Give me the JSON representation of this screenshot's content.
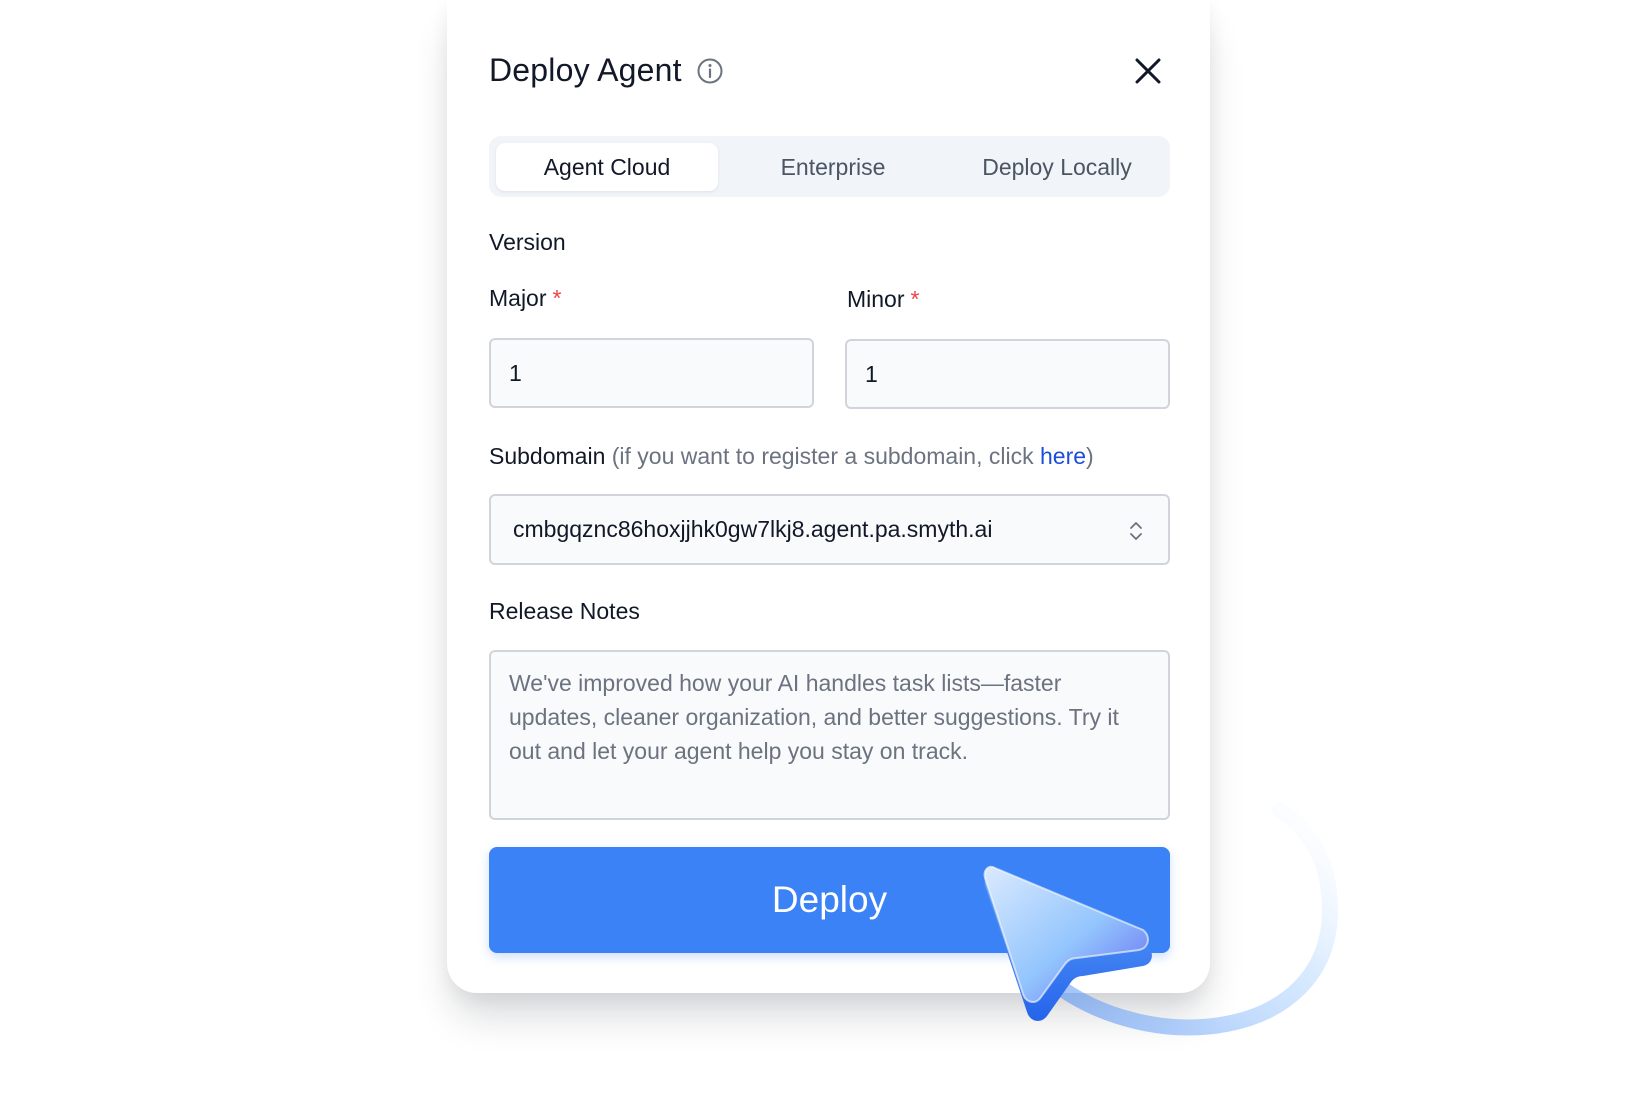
{
  "dialog": {
    "title": "Deploy Agent",
    "info_icon": "info-circle-icon",
    "close_icon": "close-icon"
  },
  "tabs": [
    {
      "label": "Agent Cloud",
      "active": true
    },
    {
      "label": "Enterprise",
      "active": false
    },
    {
      "label": "Deploy Locally",
      "active": false
    }
  ],
  "version": {
    "section_label": "Version",
    "major": {
      "label": "Major",
      "required_marker": "*",
      "value": "1"
    },
    "minor": {
      "label": "Minor",
      "required_marker": "*",
      "value": "1"
    }
  },
  "subdomain": {
    "label": "Subdomain",
    "hint_prefix": "(if you want to register a subdomain, click",
    "hint_link": "here",
    "hint_suffix": ")",
    "value": "cmbgqznc86hoxjjhk0gw7lkj8.agent.pa.smyth.ai",
    "chevron_icon": "chevron-up-down-icon"
  },
  "release_notes": {
    "label": "Release Notes",
    "value": "We've improved how your AI handles task lists—faster updates, cleaner organization, and better suggestions. Try it out and let your agent help you stay on track."
  },
  "deploy_button": {
    "label": "Deploy",
    "color": "#3b82f6"
  },
  "cursor": {
    "icon": "pointer-cursor-icon"
  },
  "colors": {
    "accent": "#3b82f6",
    "link": "#1d4ed8",
    "required": "#ef4444"
  }
}
